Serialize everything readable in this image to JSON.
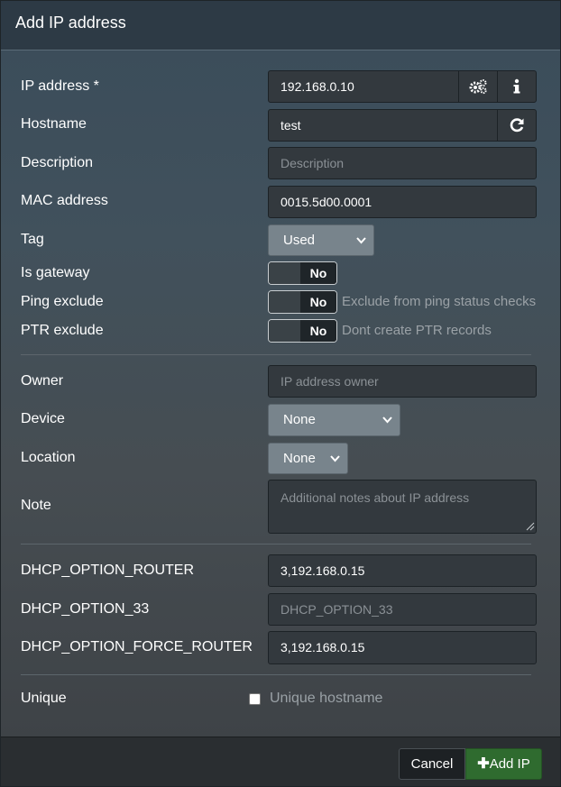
{
  "header": {
    "title": "Add IP address"
  },
  "fields": {
    "ip_address": {
      "label": "IP address *",
      "value": "192.168.0.10"
    },
    "hostname": {
      "label": "Hostname",
      "value": "test"
    },
    "description": {
      "label": "Description",
      "placeholder": "Description"
    },
    "mac": {
      "label": "MAC address",
      "value": "0015.5d00.0001"
    },
    "tag": {
      "label": "Tag",
      "value": "Used"
    },
    "is_gateway": {
      "label": "Is gateway",
      "value": "No"
    },
    "ping_exclude": {
      "label": "Ping exclude",
      "value": "No",
      "help": "Exclude from ping status checks"
    },
    "ptr_exclude": {
      "label": "PTR exclude",
      "value": "No",
      "help": "Dont create PTR records"
    },
    "owner": {
      "label": "Owner",
      "placeholder": "IP address owner"
    },
    "device": {
      "label": "Device",
      "value": "None"
    },
    "location": {
      "label": "Location",
      "value": "None"
    },
    "note": {
      "label": "Note",
      "placeholder": "Additional notes about IP address"
    },
    "dhcp_router": {
      "label": "DHCP_OPTION_ROUTER",
      "value": "3,192.168.0.15"
    },
    "dhcp_33": {
      "label": "DHCP_OPTION_33",
      "placeholder": "DHCP_OPTION_33"
    },
    "dhcp_force_router": {
      "label": "DHCP_OPTION_FORCE_ROUTER",
      "value": "3,192.168.0.15"
    },
    "unique": {
      "label": "Unique",
      "checkbox_label": "Unique hostname",
      "checked": false
    }
  },
  "footer": {
    "cancel_label": "Cancel",
    "add_label": "Add IP"
  },
  "colors": {
    "add_button": "#2f6b2f",
    "select_bg": "#78848c"
  },
  "icons": {
    "ip_tools": "gears-icon",
    "ip_info": "info-icon",
    "hostname_refresh": "refresh-icon",
    "add": "plus-icon",
    "dropdown": "chevron-down-icon"
  }
}
